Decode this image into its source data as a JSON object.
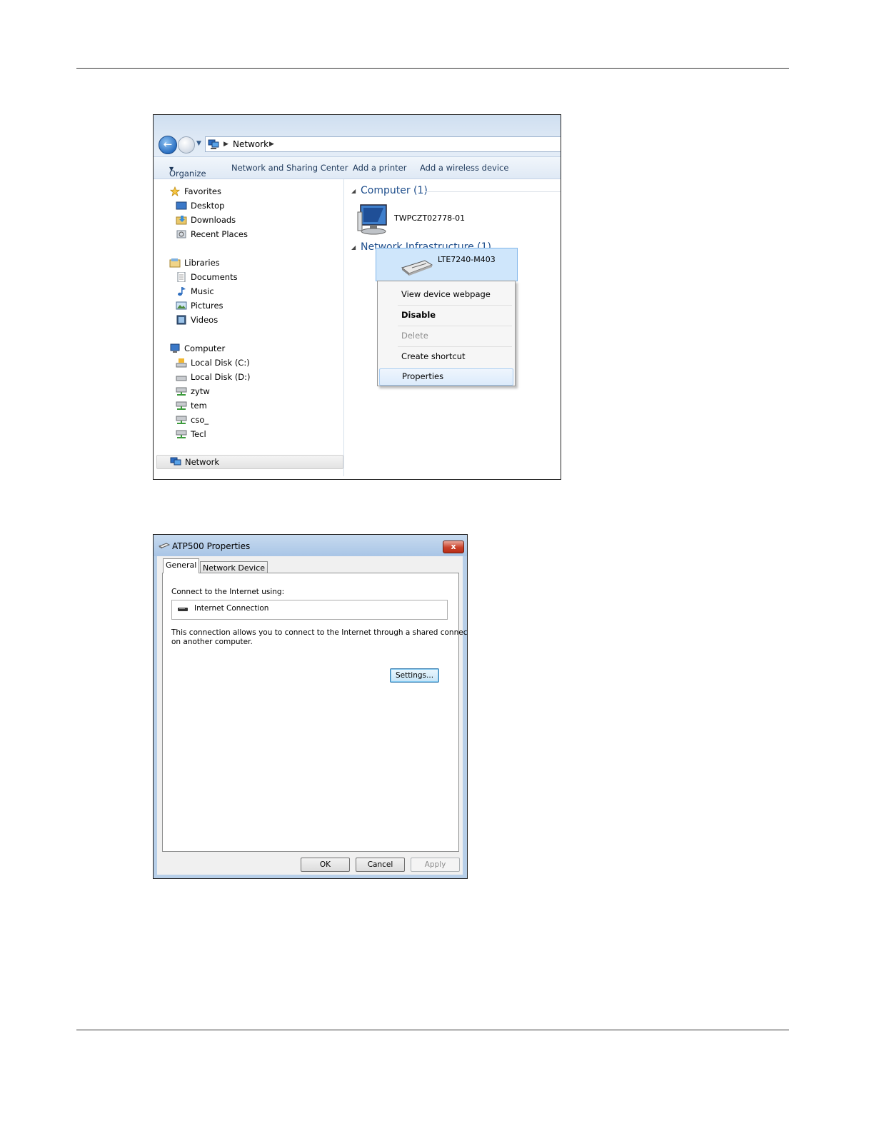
{
  "explorer": {
    "address": {
      "crumb": "Network"
    },
    "commandbar": {
      "organize": "Organize",
      "network_sharing": "Network and Sharing Center",
      "add_printer": "Add a printer",
      "add_wireless": "Add a wireless device"
    },
    "nav": {
      "favorites": "Favorites",
      "desktop": "Desktop",
      "downloads": "Downloads",
      "recent_places": "Recent Places",
      "libraries": "Libraries",
      "documents": "Documents",
      "music": "Music",
      "pictures": "Pictures",
      "videos": "Videos",
      "computer": "Computer",
      "local_disk_c": "Local Disk (C:)",
      "local_disk_d": "Local Disk (D:)",
      "net_share_1": "zytw",
      "net_share_2": "tem",
      "net_share_3": "cso_",
      "net_share_4": "Tecl",
      "network": "Network"
    },
    "content": {
      "computer_group": "Computer (1)",
      "computer_name": "TWPCZT02778-01",
      "infrastructure_group": "Network Infrastructure (1)",
      "device_name": "LTE7240-M403"
    },
    "context_menu": {
      "view_webpage": "View device webpage",
      "disable": "Disable",
      "delete": "Delete",
      "create_shortcut": "Create shortcut",
      "properties": "Properties"
    }
  },
  "dialog": {
    "title": "ATP500 Properties",
    "close": "x",
    "tabs": {
      "general": "General",
      "network_device": "Network Device"
    },
    "connect_label": "Connect to the Internet using:",
    "connection_name": "Internet Connection",
    "description_line1": "This connection allows you to connect to the Internet through a shared connection",
    "description_line2": "on another computer.",
    "settings_button": "Settings...",
    "ok_button": "OK",
    "cancel_button": "Cancel",
    "apply_button": "Apply"
  }
}
